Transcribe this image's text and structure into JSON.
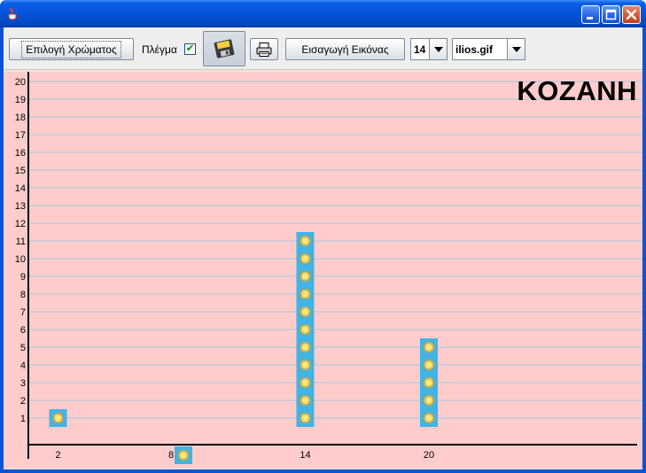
{
  "window": {
    "title": ""
  },
  "toolbar": {
    "color_button_label": "Επιλογή Χρώματος",
    "grid_label": "Πλέγμα",
    "grid_checked": true,
    "save_icon": "floppy-disk-icon",
    "print_icon": "printer-icon",
    "insert_image_label": "Εισαγωγή Εικόνας",
    "size_value": "14",
    "image_value": "ilios.gif"
  },
  "chart_data": {
    "type": "bar",
    "title": "KOZANH",
    "xlabel": "",
    "ylabel": "",
    "categories": [
      "2",
      "8",
      "14",
      "20"
    ],
    "values": [
      1,
      0,
      11,
      5
    ],
    "ylim": [
      0,
      20
    ],
    "yticks": [
      1,
      2,
      3,
      4,
      5,
      6,
      7,
      8,
      9,
      10,
      11,
      12,
      13,
      14,
      15,
      16,
      17,
      18,
      19,
      20
    ],
    "grid": true,
    "marker_icon": "sun-icon",
    "colors": {
      "background": "#ffcccc",
      "grid": "#a8c8dc",
      "marker_bg": "#3fb4e6",
      "marker_sun": "#f2df6a"
    }
  }
}
